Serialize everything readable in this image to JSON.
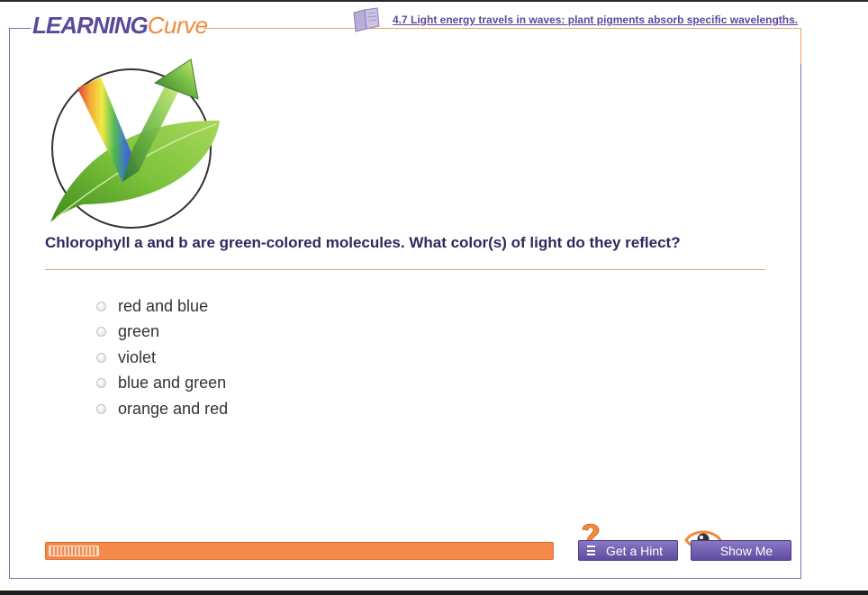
{
  "header": {
    "logo_part1": "LEARNING",
    "logo_part2": "Curve",
    "topic_link": "4.7 Light energy travels in waves: plant pigments absorb specific wavelengths."
  },
  "question": {
    "text": "Chlorophyll a and b are green-colored molecules. What color(s) of light do they reflect?"
  },
  "options": [
    {
      "label": "red and blue"
    },
    {
      "label": "green"
    },
    {
      "label": "violet"
    },
    {
      "label": "blue and green"
    },
    {
      "label": "orange and red"
    }
  ],
  "progress": {
    "fraction": 0.1
  },
  "buttons": {
    "hint_label": "Get a Hint",
    "show_label": "Show Me"
  },
  "colors": {
    "brand_purple": "#5b4a9b",
    "brand_orange": "#f08a3c",
    "question_text": "#2c2a5c"
  },
  "icons": [
    "book-icon",
    "hint-question-icon",
    "eye-icon",
    "leaf-spectrum-arrow-image"
  ]
}
